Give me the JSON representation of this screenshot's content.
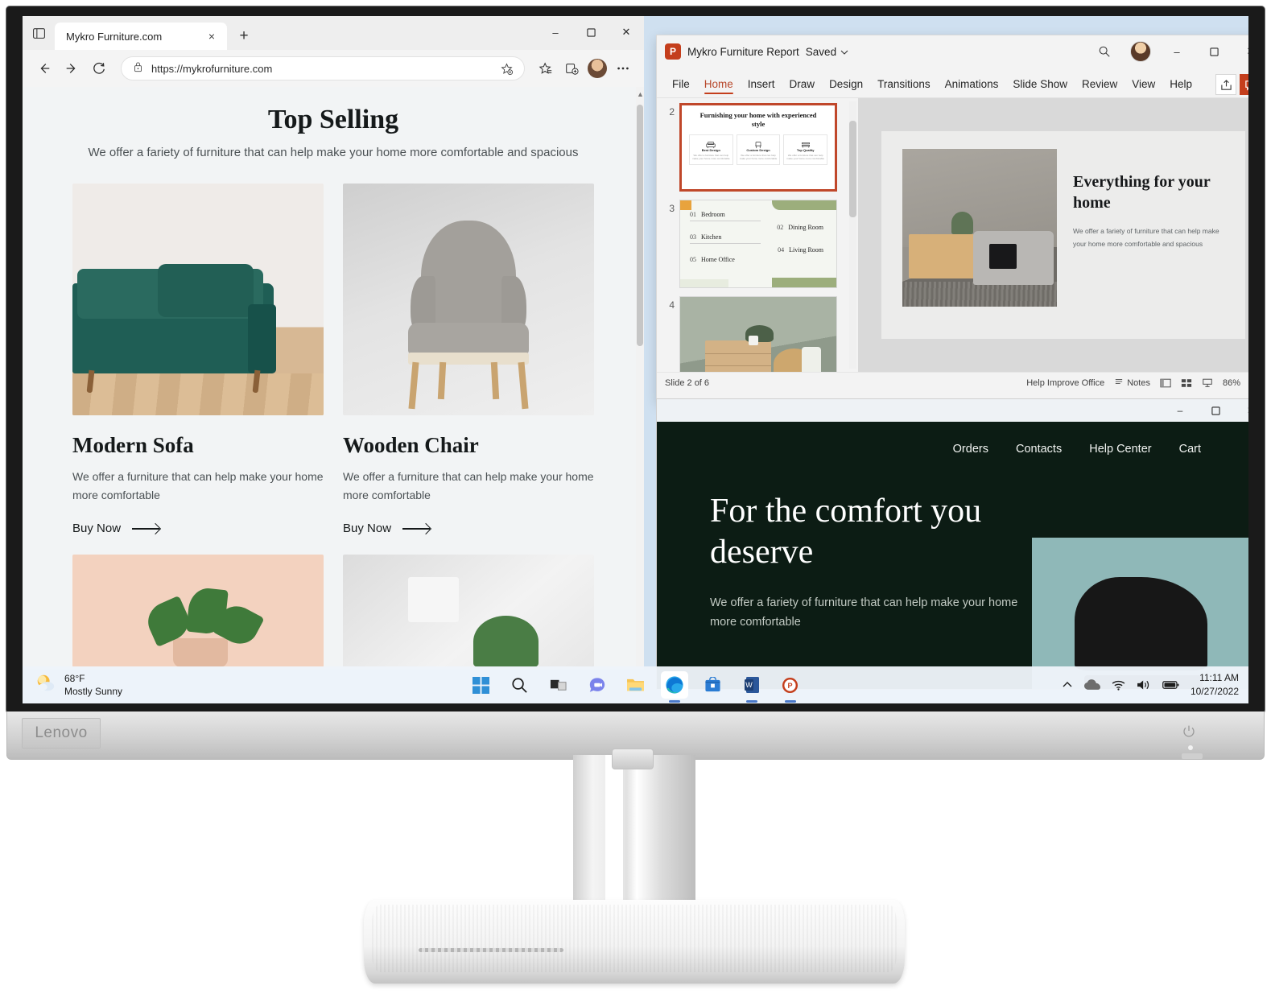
{
  "browser": {
    "tab_title": "Mykro Furniture.com",
    "url": "https://mykrofurniture.com",
    "new_tab_label": "+",
    "close_tab_label": "×",
    "minimize_label": "–",
    "maximize_label": "☐",
    "close_label": "✕",
    "icons": {
      "tab_actions": "tab-actions-icon",
      "back": "back-arrow-icon",
      "forward": "forward-arrow-icon",
      "refresh": "refresh-icon",
      "lock": "lock-icon",
      "favorite_add": "add-favorite-icon",
      "favorites": "favorites-icon",
      "collections": "collections-icon",
      "profile": "profile-avatar",
      "settings": "more-options-icon"
    }
  },
  "website": {
    "heading": "Top Selling",
    "subheading": "We offer a fariety of furniture that can help make your home more comfortable and spacious",
    "products": [
      {
        "name": "Modern Sofa",
        "description": "We offer a furniture that can help make your home more comfortable",
        "cta": "Buy Now"
      },
      {
        "name": "Wooden Chair",
        "description": "We offer a furniture that can help make your home more comfortable",
        "cta": "Buy Now"
      }
    ]
  },
  "powerpoint": {
    "app_badge": "P",
    "document_name": "Mykro Furniture Report",
    "save_state": "Saved",
    "save_state_caret": "⌄",
    "ribbon_tabs": [
      "File",
      "Home",
      "Insert",
      "Draw",
      "Design",
      "Transitions",
      "Animations",
      "Slide Show",
      "Review",
      "View",
      "Help"
    ],
    "active_tab": "Home",
    "share_label": "share-icon",
    "comments_label": "comments-icon",
    "window_controls": {
      "minimize": "–",
      "maximize": "☐",
      "close": "✕"
    },
    "thumbnails": [
      {
        "number": "2",
        "selected": true,
        "title": "Furnishing your home with experienced style",
        "cards": [
          {
            "title": "Best Design",
            "text": "We offer a furniture that can help make your home more comfortable"
          },
          {
            "title": "Custom Design",
            "text": "We offer a furniture that can help make your home more comfortable"
          },
          {
            "title": "Top Quality",
            "text": "We offer a furniture that can help make your home more comfortable"
          }
        ]
      },
      {
        "number": "3",
        "selected": false,
        "items": [
          {
            "num": "01",
            "label": "Bedroom"
          },
          {
            "num": "02",
            "label": "Dining Room"
          },
          {
            "num": "03",
            "label": "Kitchen"
          },
          {
            "num": "04",
            "label": "Living Room"
          },
          {
            "num": "05",
            "label": "Home Office"
          }
        ]
      },
      {
        "number": "4",
        "selected": false,
        "photo": true
      }
    ],
    "slide": {
      "heading": "Everything for your home",
      "body": "We offer a fariety of furniture that can help make your home more comfortable and spacious"
    },
    "status": {
      "slide_counter": "Slide 2 of 6",
      "help_improve": "Help Improve Office",
      "notes": "Notes",
      "zoom": "86%",
      "view_normal": "normal-view-icon",
      "view_sorter": "slide-sorter-icon",
      "view_reading": "reading-view-icon",
      "fit_slide": "fit-to-window-icon"
    }
  },
  "site_preview": {
    "nav": [
      "Orders",
      "Contacts",
      "Help Center",
      "Cart"
    ],
    "hero_heading": "For the comfort you deserve",
    "hero_body": "We offer a fariety of furniture that can help make your home more comfortable",
    "window_controls": {
      "minimize": "–",
      "maximize": "☐",
      "close": "✕"
    }
  },
  "taskbar": {
    "weather": {
      "temperature": "68°F",
      "condition": "Mostly Sunny",
      "icon": "sun-cloud-icon"
    },
    "apps": [
      {
        "name": "start-button",
        "icon": "windows-logo-icon"
      },
      {
        "name": "search-button",
        "icon": "search-icon"
      },
      {
        "name": "task-view-button",
        "icon": "task-view-icon"
      },
      {
        "name": "chat-button",
        "icon": "chat-icon"
      },
      {
        "name": "file-explorer-button",
        "icon": "folder-icon"
      },
      {
        "name": "edge-button",
        "icon": "edge-icon"
      },
      {
        "name": "microsoft-store-button",
        "icon": "store-icon"
      },
      {
        "name": "word-button",
        "icon": "word-icon"
      },
      {
        "name": "powerpoint-button",
        "icon": "powerpoint-icon"
      }
    ],
    "tray": {
      "overflow": "show-hidden-icons",
      "cloud": "onedrive-icon",
      "wifi": "wifi-icon",
      "volume": "volume-icon",
      "battery": "battery-icon",
      "time": "11:11 AM",
      "date": "10/27/2022"
    }
  },
  "monitor": {
    "brand": "Lenovo",
    "power_icon": "power-button-icon"
  },
  "colors": {
    "accent_ppt": "#c43e1c",
    "site_dark": "#0c1c14",
    "hero_panel": "#8fb8b8",
    "sofa_green": "#1f5e55"
  }
}
